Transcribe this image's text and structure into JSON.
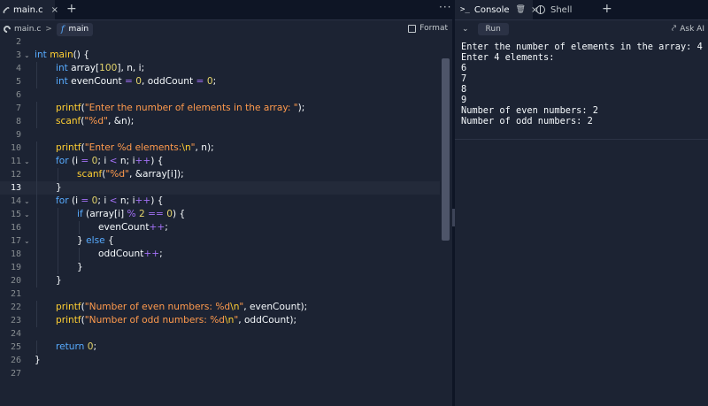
{
  "editor": {
    "tab": {
      "label": "main.c",
      "close": "×"
    },
    "add_tab": "+",
    "more": "···",
    "breadcrumb": {
      "file": "main.c",
      "separator": ">",
      "function_icon": "f",
      "function": "main"
    },
    "format_label": "Format",
    "current_line": 13,
    "lines": [
      {
        "n": "2",
        "t": []
      },
      {
        "n": "3",
        "fold": true,
        "t": [
          [
            "ty",
            "int"
          ],
          [
            "pl",
            " "
          ],
          [
            "fn",
            "main"
          ],
          [
            "pl",
            "() {"
          ]
        ]
      },
      {
        "n": "4",
        "t": [
          [
            "ty",
            "int"
          ],
          [
            "pl",
            " array["
          ],
          [
            "num",
            "100"
          ],
          [
            "pl",
            "], n, i;"
          ]
        ]
      },
      {
        "n": "5",
        "t": [
          [
            "ty",
            "int"
          ],
          [
            "pl",
            " evenCount "
          ],
          [
            "op",
            "="
          ],
          [
            "pl",
            " "
          ],
          [
            "num",
            "0"
          ],
          [
            "pl",
            ", oddCount "
          ],
          [
            "op",
            "="
          ],
          [
            "pl",
            " "
          ],
          [
            "num",
            "0"
          ],
          [
            "pl",
            ";"
          ]
        ]
      },
      {
        "n": "6",
        "t": []
      },
      {
        "n": "7",
        "t": [
          [
            "fn",
            "printf"
          ],
          [
            "pl",
            "("
          ],
          [
            "str",
            "\"Enter the number of elements in the array: \""
          ],
          [
            "pl",
            ");"
          ]
        ]
      },
      {
        "n": "8",
        "t": [
          [
            "fn",
            "scanf"
          ],
          [
            "pl",
            "("
          ],
          [
            "str",
            "\"%d\""
          ],
          [
            "pl",
            ", &n);"
          ]
        ]
      },
      {
        "n": "9",
        "t": []
      },
      {
        "n": "10",
        "t": [
          [
            "fn",
            "printf"
          ],
          [
            "pl",
            "("
          ],
          [
            "str",
            "\"Enter %d elements:"
          ],
          [
            "esc",
            "\\n"
          ],
          [
            "str",
            "\""
          ],
          [
            "pl",
            ", n);"
          ]
        ]
      },
      {
        "n": "11",
        "fold": true,
        "t": [
          [
            "kw",
            "for"
          ],
          [
            "pl",
            " (i "
          ],
          [
            "op",
            "="
          ],
          [
            "pl",
            " "
          ],
          [
            "num",
            "0"
          ],
          [
            "pl",
            "; i "
          ],
          [
            "op",
            "<"
          ],
          [
            "pl",
            " n; i"
          ],
          [
            "op",
            "++"
          ],
          [
            "pl",
            ") {"
          ]
        ]
      },
      {
        "n": "12",
        "t": [
          [
            "fn",
            "scanf"
          ],
          [
            "pl",
            "("
          ],
          [
            "str",
            "\"%d\""
          ],
          [
            "pl",
            ", &array[i]);"
          ]
        ]
      },
      {
        "n": "13",
        "t": [
          [
            "pl",
            "}"
          ]
        ]
      },
      {
        "n": "14",
        "fold": true,
        "t": [
          [
            "kw",
            "for"
          ],
          [
            "pl",
            " (i "
          ],
          [
            "op",
            "="
          ],
          [
            "pl",
            " "
          ],
          [
            "num",
            "0"
          ],
          [
            "pl",
            "; i "
          ],
          [
            "op",
            "<"
          ],
          [
            "pl",
            " n; i"
          ],
          [
            "op",
            "++"
          ],
          [
            "pl",
            ") {"
          ]
        ]
      },
      {
        "n": "15",
        "fold": true,
        "t": [
          [
            "kw",
            "if"
          ],
          [
            "pl",
            " (array[i] "
          ],
          [
            "op",
            "%"
          ],
          [
            "pl",
            " "
          ],
          [
            "num",
            "2"
          ],
          [
            "pl",
            " "
          ],
          [
            "op",
            "=="
          ],
          [
            "pl",
            " "
          ],
          [
            "num",
            "0"
          ],
          [
            "pl",
            ") {"
          ]
        ]
      },
      {
        "n": "16",
        "t": [
          [
            "pl",
            "evenCount"
          ],
          [
            "op",
            "++"
          ],
          [
            "pl",
            ";"
          ]
        ]
      },
      {
        "n": "17",
        "fold": true,
        "t": [
          [
            "pl",
            "} "
          ],
          [
            "kw",
            "else"
          ],
          [
            "pl",
            " {"
          ]
        ]
      },
      {
        "n": "18",
        "t": [
          [
            "pl",
            "oddCount"
          ],
          [
            "op",
            "++"
          ],
          [
            "pl",
            ";"
          ]
        ]
      },
      {
        "n": "19",
        "t": [
          [
            "pl",
            "}"
          ]
        ]
      },
      {
        "n": "20",
        "t": [
          [
            "pl",
            "}"
          ]
        ]
      },
      {
        "n": "21",
        "t": []
      },
      {
        "n": "22",
        "t": [
          [
            "fn",
            "printf"
          ],
          [
            "pl",
            "("
          ],
          [
            "str",
            "\"Number of even numbers: %d"
          ],
          [
            "esc",
            "\\n"
          ],
          [
            "str",
            "\""
          ],
          [
            "pl",
            ", evenCount);"
          ]
        ]
      },
      {
        "n": "23",
        "t": [
          [
            "fn",
            "printf"
          ],
          [
            "pl",
            "("
          ],
          [
            "str",
            "\"Number of odd numbers: %d"
          ],
          [
            "esc",
            "\\n"
          ],
          [
            "str",
            "\""
          ],
          [
            "pl",
            ", oddCount);"
          ]
        ]
      },
      {
        "n": "24",
        "t": []
      },
      {
        "n": "25",
        "t": [
          [
            "kw",
            "return"
          ],
          [
            "pl",
            " "
          ],
          [
            "num",
            "0"
          ],
          [
            "pl",
            ";"
          ]
        ]
      },
      {
        "n": "26",
        "t": [
          [
            "pl",
            "}"
          ]
        ]
      },
      {
        "n": "27",
        "t": []
      }
    ]
  },
  "console": {
    "tabs": {
      "console_label": "Console",
      "console_icon": ">_",
      "console_close": "×",
      "shell_label": "Shell",
      "add": "+"
    },
    "toolbar": {
      "chevron": "⌄",
      "run_label": "Run",
      "ask_ai_label": "Ask AI"
    },
    "output": [
      "Enter the number of elements in the array: 4",
      "Enter 4 elements:",
      "6",
      "7",
      "8",
      "9",
      "Number of even numbers: 2",
      "Number of odd numbers: 2"
    ]
  },
  "colors": {
    "background": "#1c2333",
    "tabbar": "#0e1525",
    "keyword": "#57abff",
    "function": "#ffcf33",
    "string": "#ff9a4d",
    "number": "#e4d46b",
    "operator": "#a371f7"
  }
}
